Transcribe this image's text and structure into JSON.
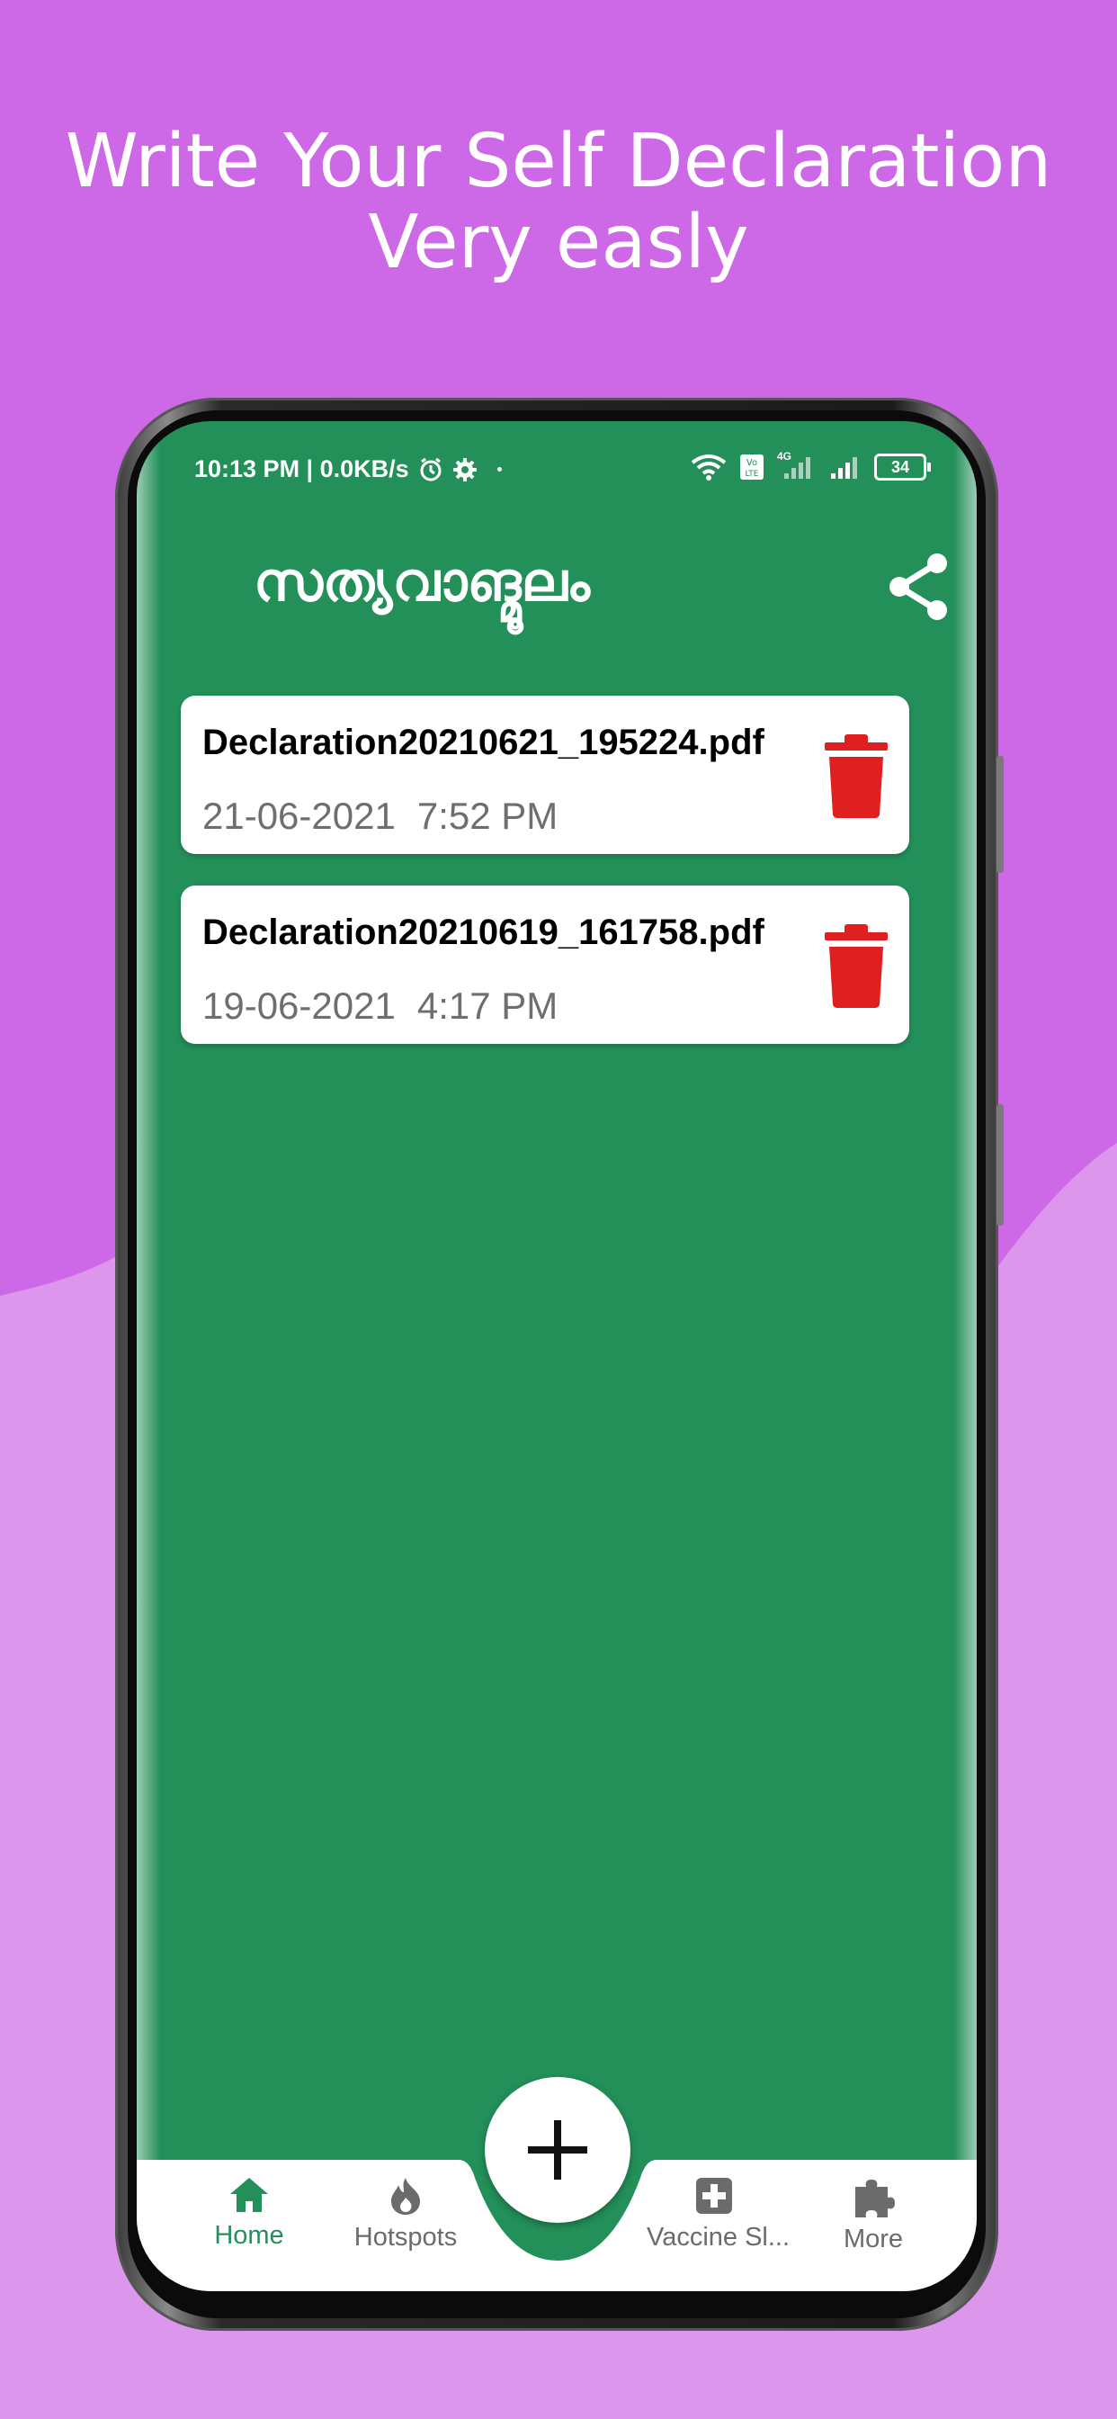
{
  "promo": {
    "line1": "Write Your Self Declaration",
    "line2": "Very easly"
  },
  "status_bar": {
    "time_and_speed": "10:13 PM | 0.0KB/s",
    "network": "4G",
    "battery": "34"
  },
  "app": {
    "title": "സത്യവാങ്മൂലം",
    "share_icon": "share-icon"
  },
  "files": [
    {
      "name": "Declaration20210621_195224.pdf",
      "date": "21-06-2021",
      "time": "7:52 PM"
    },
    {
      "name": "Declaration20210619_161758.pdf",
      "date": "19-06-2021",
      "time": "4:17 PM"
    }
  ],
  "fab": {
    "icon": "plus-icon"
  },
  "bottom_nav": {
    "items": [
      {
        "label": "Home",
        "icon": "home-icon"
      },
      {
        "label": "Hotspots",
        "icon": "flame-icon"
      },
      {
        "label": "Vaccine Sl...",
        "icon": "medical-cross-icon"
      },
      {
        "label": "More",
        "icon": "puzzle-icon"
      }
    ]
  },
  "colors": {
    "background_top": "#cd68e6",
    "background_bottom": "#dc96ec",
    "app_green": "#238f59",
    "delete_red": "#e02020"
  }
}
